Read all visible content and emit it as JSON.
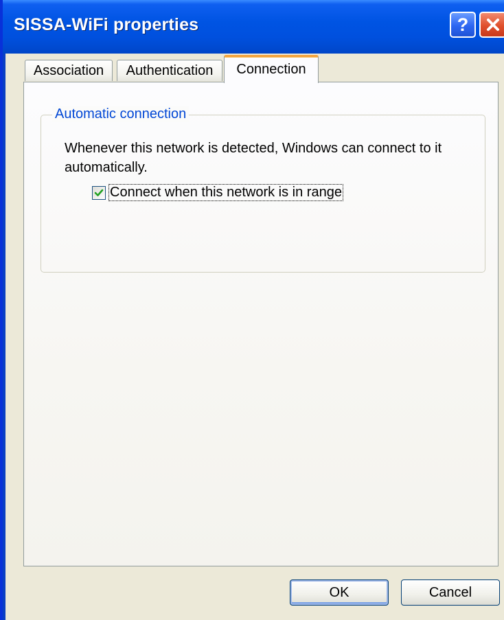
{
  "window": {
    "title": "SISSA-WiFi properties",
    "help_icon": "question-mark-icon",
    "close_icon": "close-x-icon"
  },
  "tabs": [
    {
      "label": "Association",
      "selected": false
    },
    {
      "label": "Authentication",
      "selected": false
    },
    {
      "label": "Connection",
      "selected": true
    }
  ],
  "group": {
    "title": "Automatic connection",
    "description": "Whenever this network is detected, Windows can connect to it automatically.",
    "checkbox_label": "Connect when this network is in range",
    "checkbox_checked": true
  },
  "buttons": {
    "ok": "OK",
    "cancel": "Cancel"
  },
  "colors": {
    "title_bar": "#0054e3",
    "dialog_background": "#ece9d8",
    "group_title": "#0046d5",
    "active_tab_highlight": "#f2a13a",
    "close_button": "#e0502c",
    "checkmark": "#21a121"
  }
}
